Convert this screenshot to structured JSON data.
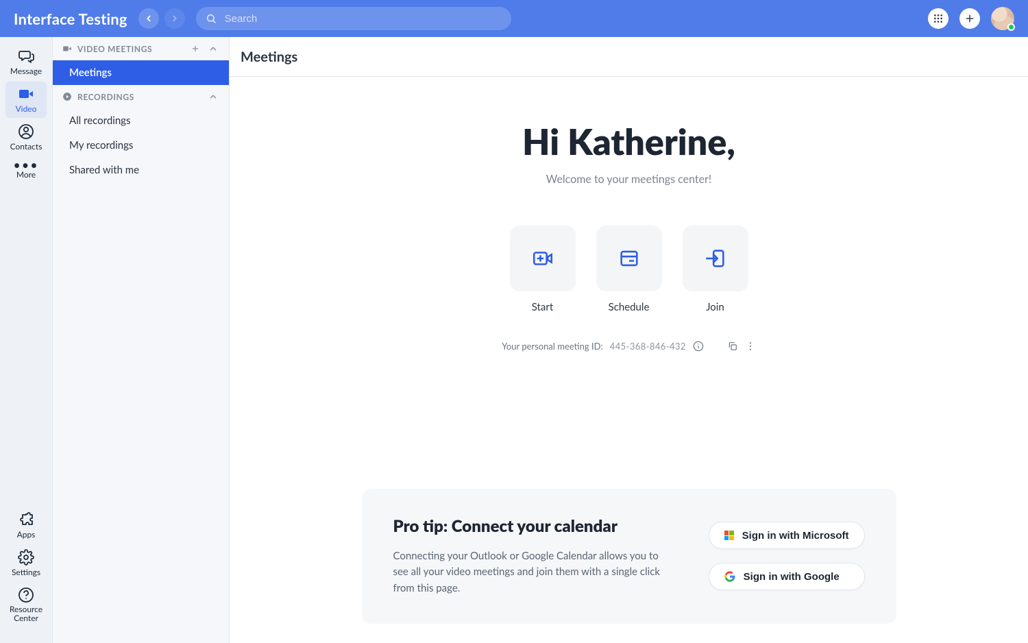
{
  "header": {
    "app_title": "Interface Testing",
    "search_placeholder": "Search"
  },
  "rail": {
    "message": "Message",
    "video": "Video",
    "contacts": "Contacts",
    "more": "More",
    "apps": "Apps",
    "settings": "Settings",
    "resource_center": "Resource Center"
  },
  "sidebar": {
    "video_meetings_header": "VIDEO MEETINGS",
    "meetings": "Meetings",
    "recordings_header": "RECORDINGS",
    "recordings": {
      "all": "All recordings",
      "mine": "My recordings",
      "shared": "Shared with me"
    }
  },
  "main": {
    "page_title": "Meetings",
    "greeting": "Hi Katherine,",
    "subgreeting": "Welcome to your meetings center!",
    "actions": {
      "start": "Start",
      "schedule": "Schedule",
      "join": "Join"
    },
    "pmi": {
      "label": "Your personal meeting ID:",
      "value": "445-368-846-432"
    },
    "protip": {
      "title": "Pro tip: Connect your calendar",
      "body": "Connecting your Outlook or Google Calendar allows you to see all your video meetings and join them with a single click from this page.",
      "ms_label": "Sign in with Microsoft",
      "google_label": "Sign in with Google"
    }
  }
}
